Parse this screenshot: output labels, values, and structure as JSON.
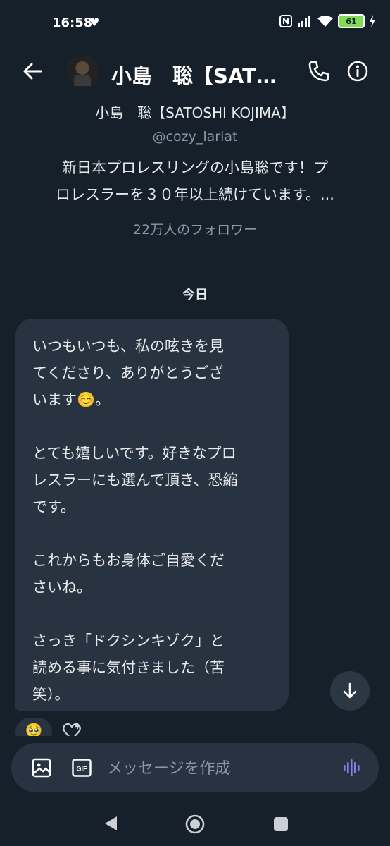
{
  "status_bar": {
    "time": "16:58",
    "battery": "61",
    "icons": [
      "heart-icon",
      "nfc-icon",
      "signal-icon",
      "wifi-icon",
      "battery-icon",
      "charging-icon"
    ]
  },
  "header": {
    "title": "小島　聡【SATOSHI KOJIMA】",
    "icons": [
      "back-arrow-icon",
      "avatar",
      "phone-icon",
      "info-icon"
    ]
  },
  "profile": {
    "name": "小島　聡【SATOSHI KOJIMA】",
    "handle": "@cozy_lariat",
    "bio_line1": "新日本プロレスリングの小島聡です！プ",
    "bio_line2": "ロレスラーを３０年以上続けています。...",
    "followers": "22万人のフォロワー"
  },
  "conversation": {
    "date_label": "今日",
    "message_paragraphs": [
      "いつもいつも、私の呟きを見\nてくださり、ありがとうござ\nいます☺️。",
      "とても嬉しいです。好きなプロ\nレスラーにも選んで頂き、恐縮\nです。",
      "これからもお身体ご自愛くだ\nさいね。",
      "さっき「ドクシンキゾク」と\n読める事に気付きました（苦\n笑）。"
    ],
    "reaction_emoji": "🥹"
  },
  "composer": {
    "placeholder": "メッセージを作成",
    "gif_label": "GIF"
  },
  "colors": {
    "background": "#15202b",
    "bubble": "#273340",
    "secondary_text": "#8b98a5",
    "voice_accent": "#8a7cf0"
  }
}
